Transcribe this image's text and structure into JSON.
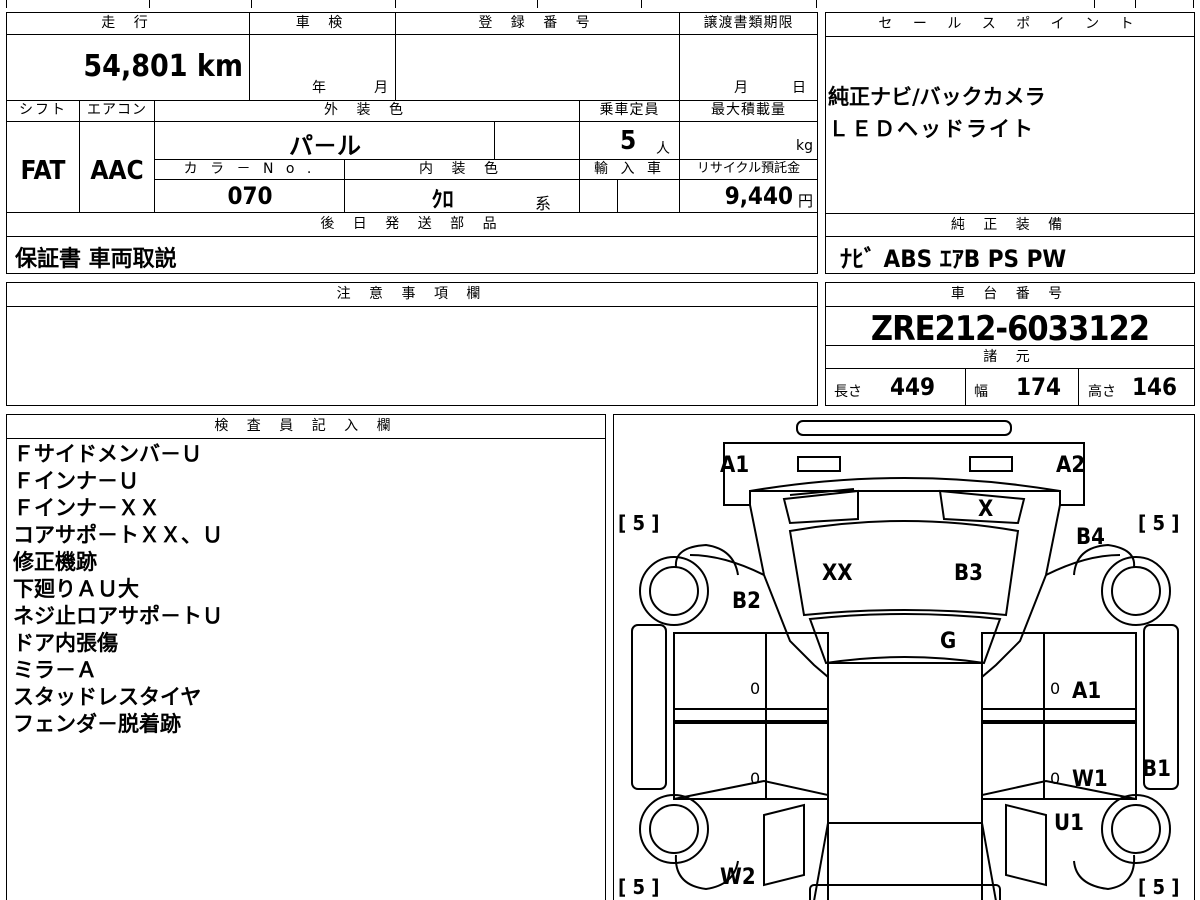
{
  "header": {
    "mileage_label": "走 行",
    "inspection_label": "車 検",
    "registration_label": "登 録 番 号",
    "transfer_deadline_label": "譲渡書類期限",
    "mileage_value": "54,801 km",
    "inspection_year": "年",
    "inspection_month": "月",
    "transfer_month": "月",
    "transfer_day": "日"
  },
  "specs": {
    "shift_label": "シフト",
    "aircon_label": "エアコン",
    "exterior_color_label": "外 装 色",
    "capacity_label": "乗車定員",
    "max_load_label": "最大積載量",
    "shift_value": "FAT",
    "aircon_value": "AAC",
    "exterior_color_value": "パ－ル",
    "capacity_value": "5",
    "capacity_unit": "人",
    "max_load_unit": "kg",
    "color_no_label": "カ ラ － N o .",
    "interior_color_label": "内 装 色",
    "import_label": "輸 入 車",
    "recycle_label": "リサイクル預託金",
    "color_no_value": "070",
    "interior_color_value": "ｸﾛ",
    "interior_color_suffix": "系",
    "recycle_value": "9,440",
    "recycle_unit": "円"
  },
  "later_parts": {
    "label": "後 日 発 送 部 品",
    "value": "保証書 車両取説"
  },
  "notes": {
    "label": "注 意 事 項 欄"
  },
  "sales_point": {
    "label": "セ ー ル ス ポ イ ン ト",
    "line1": "純正ナビ/バックカメラ",
    "line2": "ＬＥＤヘッドライト"
  },
  "equipment": {
    "label": "純 正 装 備",
    "value": "ﾅﾋﾞ ABS ｴｱB PS PW"
  },
  "chassis": {
    "label": "車 台 番 号",
    "value": "ZRE212-6033122",
    "dims_label": "諸 元",
    "length_label": "長さ",
    "length_value": "449",
    "width_label": "幅",
    "width_value": "174",
    "height_label": "高さ",
    "height_value": "146"
  },
  "inspector": {
    "label": "検 査 員 記 入 欄",
    "lines": [
      "Ｆサイドメンバ－Ｕ",
      "Ｆインナ－Ｕ",
      "Ｆインナ－ＸＸ",
      "コアサポ－トＸＸ、Ｕ",
      "修正機跡",
      "下廻りＡＵ大",
      "ネジ止ロアサポ－トＵ",
      "ドア内張傷",
      "ミラ－Ａ",
      "スタッドレスタイヤ",
      "フェンダ－脱着跡"
    ]
  },
  "diagram": {
    "labels": {
      "a1_front_left": "A1",
      "a2_front_right": "A2",
      "x_hood": "X",
      "b4_right_fender": "B4",
      "xx_hood": "XX",
      "b3_hood": "B3",
      "b2_left_fender": "B2",
      "g_windshield": "G",
      "a1_right_door": "A1",
      "b1_right_side": "B1",
      "w1_right_door": "W1",
      "u1_right_rear": "U1",
      "w2_left_rear": "W2"
    },
    "tire_fl": "[ 5 ]",
    "tire_fr": "[ 5 ]",
    "tire_rl": "[ 5 ]",
    "tire_rr": "[ 5 ]",
    "door_zero_1": "0",
    "door_zero_2": "0",
    "door_zero_3": "0",
    "door_zero_4": "0"
  }
}
